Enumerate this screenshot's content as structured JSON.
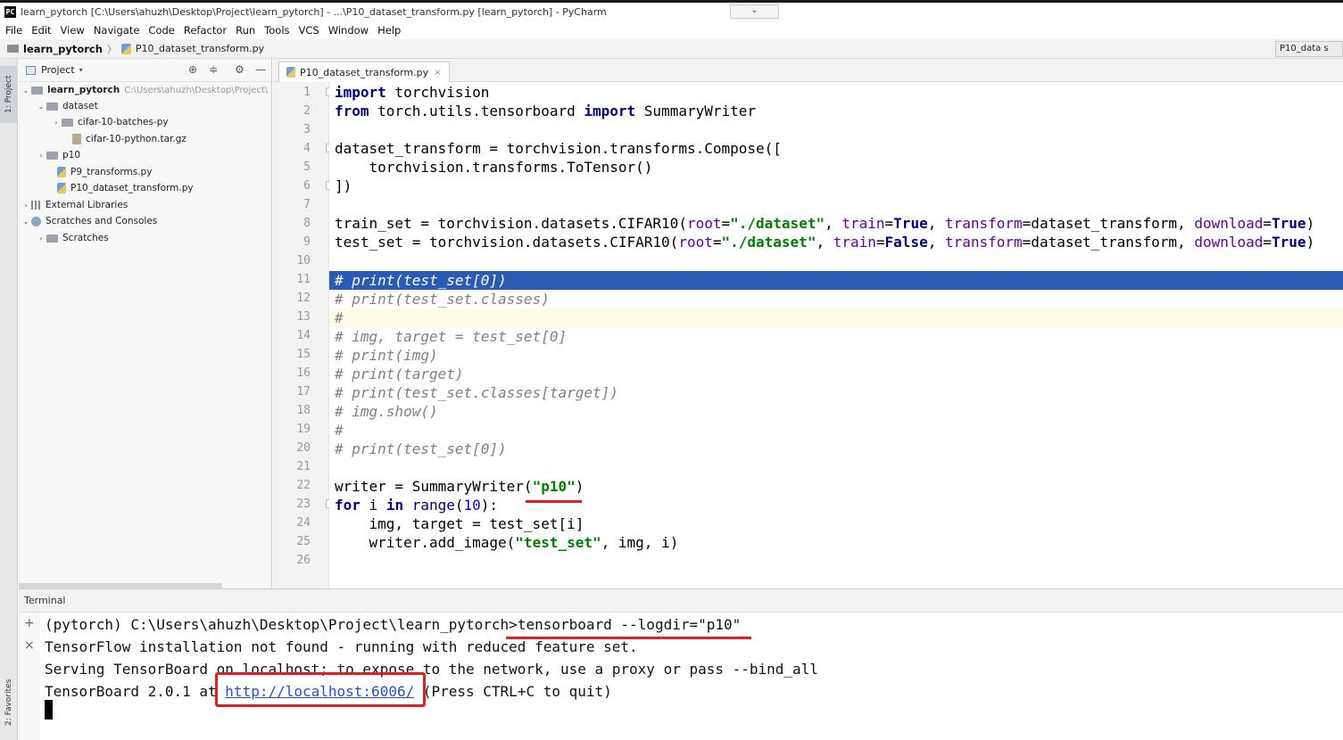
{
  "window": {
    "app_icon": "PC",
    "title": "learn_pytorch [C:\\Users\\ahuzh\\Desktop\\Project\\learn_pytorch] - ...\\P10_dataset_transform.py [learn_pytorch] - PyCharm",
    "dropdown_glyph": "⌄"
  },
  "menu": [
    "File",
    "Edit",
    "View",
    "Navigate",
    "Code",
    "Refactor",
    "Run",
    "Tools",
    "VCS",
    "Window",
    "Help"
  ],
  "breadcrumb": {
    "root": "learn_pytorch",
    "separator": "〉",
    "file": "P10_dataset_transform.py",
    "right_tab": "P10_data s"
  },
  "left_strip": {
    "project_tab": "1: Project",
    "favorites_tab": "2: Favorites"
  },
  "project_panel": {
    "header": "Project",
    "caret": "▾",
    "tools": {
      "locate": "⊕",
      "collapse": "≑",
      "settings": "⚙",
      "hide": "—"
    },
    "tree": {
      "root_name": "learn_pytorch",
      "root_path": "C:\\Users\\ahuzh\\Desktop\\Project\\",
      "dataset": "dataset",
      "batches": "cifar-10-batches-py",
      "archive": "cifar-10-python.tar.gz",
      "p10": "p10",
      "p9": "P9_transforms.py",
      "p10file": "P10_dataset_transform.py",
      "libs": "External Libraries",
      "scratches_consoles": "Scratches and Consoles",
      "scratches": "Scratches"
    },
    "arrows": {
      "open": "⌄",
      "closed": "›"
    }
  },
  "editor": {
    "tab": {
      "label": "P10_dataset_transform.py",
      "close": "×"
    },
    "line_numbers": [
      "1",
      "2",
      "3",
      "4",
      "5",
      "6",
      "7",
      "8",
      "9",
      "10",
      "11",
      "12",
      "13",
      "14",
      "15",
      "16",
      "17",
      "18",
      "19",
      "20",
      "21",
      "22",
      "23",
      "24",
      "25",
      "26"
    ],
    "code": {
      "l1_kw": "import",
      "l1_rest": " torchvision",
      "l2_kw1": "from",
      "l2_mid": " torch.utils.tensorboard ",
      "l2_kw2": "import",
      "l2_rest": " SummaryWriter",
      "l4": "dataset_transform = torchvision.transforms.Compose([",
      "l5": "    torchvision.transforms.ToTensor()",
      "l6": "])",
      "l8_a": "train_set = torchvision.datasets.CIFAR10(",
      "l8_root": "root",
      "l8_eq": "=",
      "l8_str": "\"./dataset\"",
      "l8_c1": ", ",
      "l8_train": "train",
      "l8_true": "True",
      "l8_c2": ", ",
      "l8_tr": "transform",
      "l8_trv": "=dataset_transform, ",
      "l8_dl": "download",
      "l8_dlv": "True",
      "l8_end": ")",
      "l9_a": "test_set = torchvision.datasets.CIFAR10(",
      "l9_root": "root",
      "l9_eq": "=",
      "l9_str": "\"./dataset\"",
      "l9_c1": ", ",
      "l9_train": "train",
      "l9_false": "False",
      "l9_c2": ", ",
      "l9_tr": "transform",
      "l9_trv": "=dataset_transform, ",
      "l9_dl": "download",
      "l9_dlv": "True",
      "l9_end": ")",
      "l11": "# print(test_set[0])",
      "l12": "# print(test_set.classes)",
      "l13": "#",
      "l14": "# img, target = test_set[0]",
      "l15": "# print(img)",
      "l16": "# print(target)",
      "l17": "# print(test_set.classes[target])",
      "l18": "# img.show()",
      "l19": "#",
      "l20": "# print(test_set[0])",
      "l22_a": "writer = SummaryWriter(",
      "l22_str": "\"p10\"",
      "l22_end": ")",
      "l23_kw1": "for",
      "l23_b": " i ",
      "l23_kw2": "in",
      "l23_c": " ",
      "l23_bi": "range",
      "l23_p1": "(",
      "l23_num": "10",
      "l23_end": "):",
      "l24": "    img, target = test_set[i]",
      "l25_a": "    writer.add_image(",
      "l25_str": "\"test_set\"",
      "l25_end": ", img, i)"
    }
  },
  "terminal": {
    "header": "Terminal",
    "add_btn": "+",
    "close_btn": "×",
    "line1_prompt": "(pytorch) C:\\Users\\ahuzh\\Desktop\\Project\\learn_pytorch>",
    "line1_cmd": "tensorboard --logdir=\"p10\"",
    "line2": "TensorFlow installation not found - running with reduced feature set.",
    "line3": "Serving TensorBoard on localhost; to expose to the network, use a proxy or pass --bind_all",
    "line4_pre": "TensorBoard 2.0.1 at ",
    "line4_link": "http://localhost:6006/",
    "line4_post": " (Press CTRL+C to quit)"
  },
  "colors": {
    "keyword": "#000080",
    "string": "#008000",
    "param": "#660099",
    "comment": "#808080",
    "selection": "#2a5bb5",
    "annotation_red": "#e02020",
    "link": "#2750c7"
  }
}
